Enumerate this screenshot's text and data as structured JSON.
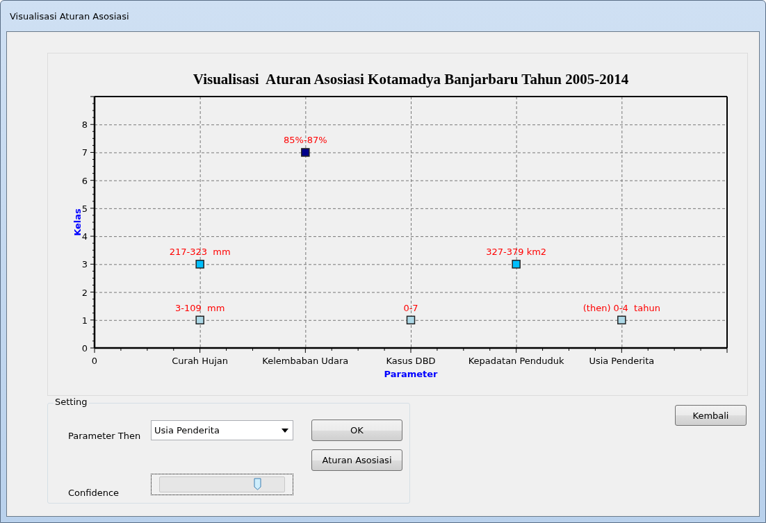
{
  "window": {
    "title": "Visualisasi Aturan Asosiasi"
  },
  "chart": {
    "chart_data": {
      "type": "scatter",
      "title": "Visualisasi  Aturan Asosiasi Kotamadya Banjarbaru Tahun 2005-2014",
      "xlabel": "Parameter",
      "ylabel": "Kelas",
      "categories": [
        "0",
        "Curah Hujan",
        "Kelembaban Udara",
        "Kasus DBD",
        "Kepadatan Penduduk",
        "Usia Penderita",
        null
      ],
      "series": [
        {
          "color": "#add8e6",
          "values": [
            null,
            1,
            null,
            1,
            null,
            1,
            null
          ]
        },
        {
          "color": "#00bfff",
          "values": [
            null,
            3,
            null,
            null,
            3,
            null,
            null
          ]
        },
        {
          "color": "#00008b",
          "values": [
            null,
            null,
            7,
            null,
            null,
            null,
            null
          ]
        }
      ],
      "ylim": [
        0,
        9
      ],
      "grid": true,
      "yticks": [
        0,
        1,
        2,
        3,
        4,
        5,
        6,
        7,
        8
      ],
      "annotations": [
        {
          "x": "Curah Hujan",
          "y": 3,
          "text": "217-323  mm"
        },
        {
          "x": "Curah Hujan",
          "y": 1,
          "text": "3-109  mm"
        },
        {
          "x": "Kelembaban Udara",
          "y": 7,
          "text": "85%-87%"
        },
        {
          "x": "Kasus DBD",
          "y": 1,
          "text": "0-7"
        },
        {
          "x": "Kepadatan Penduduk",
          "y": 3,
          "text": "327-379 km2"
        },
        {
          "x": "Usia Penderita",
          "y": 1,
          "text": "(then) 0-4  tahun"
        }
      ]
    }
  },
  "setting": {
    "title": "Setting",
    "parameter_then": {
      "label": "Parameter Then",
      "value": "Usia Penderita"
    },
    "confidence": {
      "label": "Confidence",
      "level": 0.78
    },
    "buttons": [
      "OK",
      "Aturan Asosiasi"
    ]
  },
  "back_button": "Kembali"
}
